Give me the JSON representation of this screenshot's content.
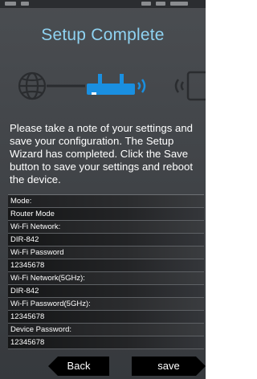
{
  "page": {
    "title": "Setup Complete",
    "description": "Please take a note of your settings and save your configuration. The Setup Wizard has completed. Click the Save button to save your settings and reboot the device."
  },
  "diagram": {
    "icons": [
      "globe-icon",
      "router-icon",
      "signal-icon",
      "device-icon"
    ],
    "accent_color": "#1a8fe0",
    "title_color": "#8fd3f2"
  },
  "settings": [
    {
      "label": "Mode:",
      "value": "Router Mode"
    },
    {
      "label": "Wi-Fi Network:",
      "value": "DIR-842"
    },
    {
      "label": "Wi-Fi Password",
      "value": "12345678"
    },
    {
      "label": "Wi-Fi Network(5GHz):",
      "value": "DIR-842"
    },
    {
      "label": "Wi-Fi Password(5GHz):",
      "value": "12345678"
    },
    {
      "label": "Device Password:",
      "value": "12345678"
    }
  ],
  "buttons": {
    "back_label": "Back",
    "save_label": "save"
  }
}
